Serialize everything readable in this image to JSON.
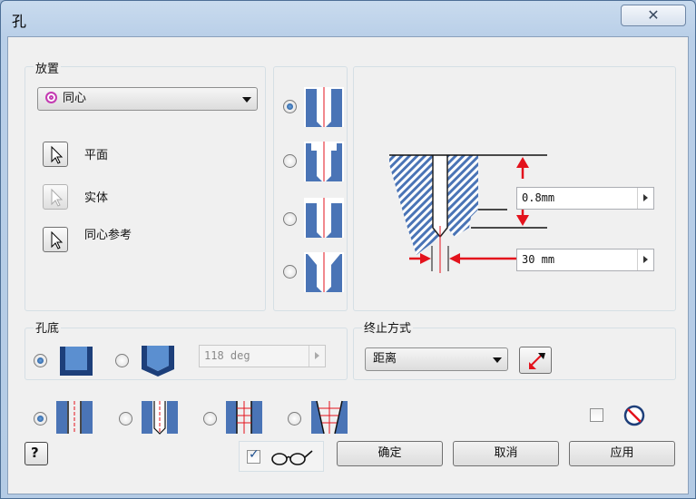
{
  "window": {
    "title": "孔",
    "close_glyph": "☒"
  },
  "placement": {
    "label": "放置",
    "combo_value": "同心",
    "items": [
      {
        "label": "平面",
        "enabled": true
      },
      {
        "label": "实体",
        "enabled": false
      },
      {
        "label": "同心参考",
        "enabled": true
      }
    ]
  },
  "hole_types": {
    "selected_index": 0,
    "count": 4
  },
  "dimensions": {
    "diameter": "0.8mm",
    "depth": "30 mm"
  },
  "bottom": {
    "label": "孔底",
    "angle_value": "118 deg",
    "selected": "flat"
  },
  "termination": {
    "label": "终止方式",
    "combo_value": "距离"
  },
  "thread_types": {
    "selected_index": 0
  },
  "buttons": {
    "ok": "确定",
    "cancel": "取消",
    "apply": "应用",
    "help_glyph": "?"
  },
  "preview": {
    "checked": true
  },
  "colors": {
    "accent_red": "#e3121c",
    "hatch_blue": "#4a74b6",
    "radio_fill": "#1d4f8f"
  }
}
